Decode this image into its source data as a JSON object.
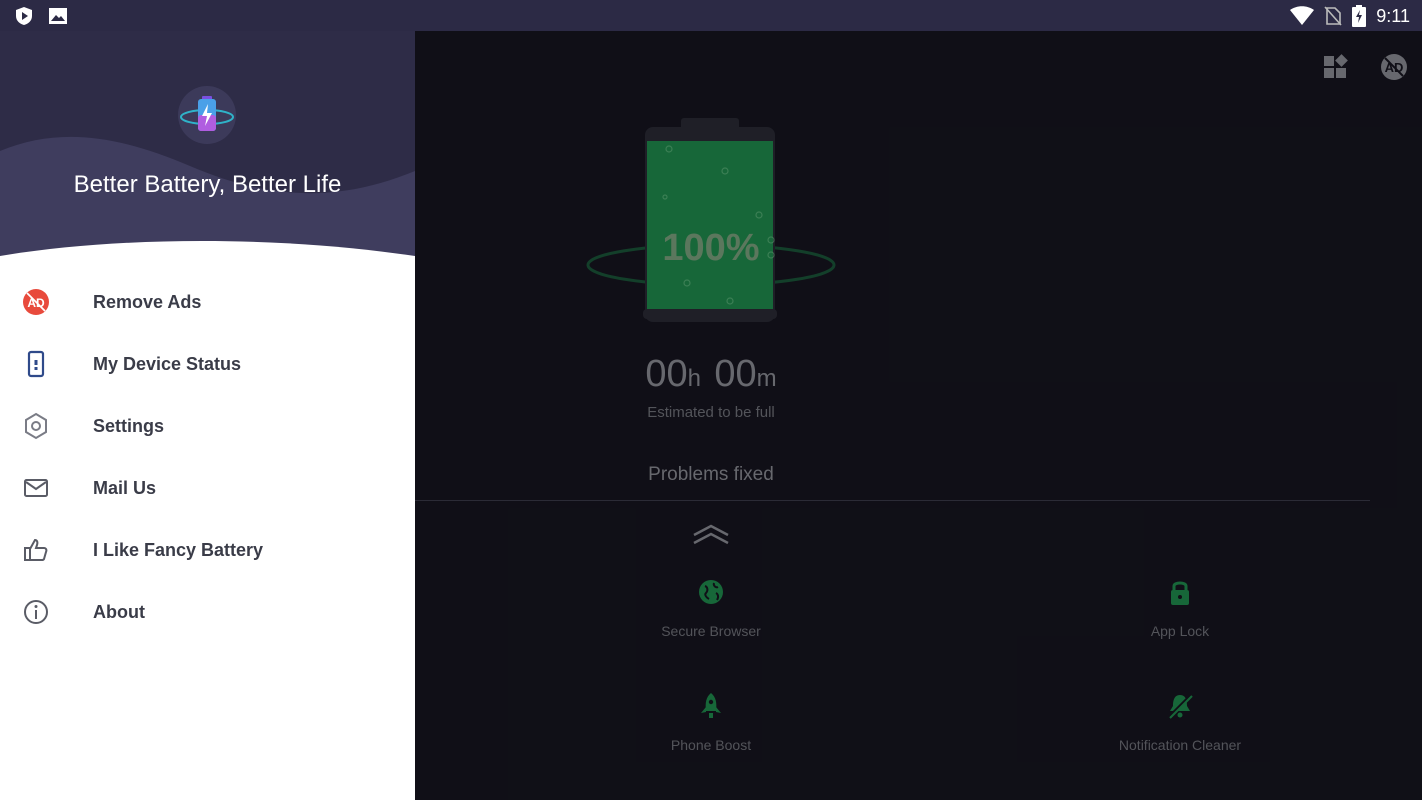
{
  "status_bar": {
    "time": "9:11",
    "left_icons": [
      "shield-play-icon",
      "image-icon"
    ],
    "right_icons": [
      "wifi-icon",
      "no-sim-icon",
      "battery-charging-icon"
    ]
  },
  "drawer": {
    "slogan": "Better Battery, Better Life",
    "items": [
      {
        "label": "Remove Ads",
        "icon": "no-ads-icon"
      },
      {
        "label": "My Device Status",
        "icon": "phone-icon"
      },
      {
        "label": "Settings",
        "icon": "gear-icon"
      },
      {
        "label": "Mail Us",
        "icon": "mail-icon"
      },
      {
        "label": "I Like Fancy Battery",
        "icon": "thumbs-up-icon"
      },
      {
        "label": "About",
        "icon": "info-icon"
      }
    ]
  },
  "main": {
    "battery_percent": "100%",
    "battery_level": 1.0,
    "hours": "00",
    "hours_unit": "h",
    "minutes": "00",
    "minutes_unit": "m",
    "estimate_label": "Estimated to be full",
    "problems_label": "Problems fixed",
    "features": [
      {
        "label": "Secure Browser",
        "icon": "globe-icon"
      },
      {
        "label": "App Lock",
        "icon": "lock-icon"
      },
      {
        "label": "Phone Boost",
        "icon": "rocket-icon"
      },
      {
        "label": "Notification Cleaner",
        "icon": "bell-off-icon"
      }
    ]
  },
  "colors": {
    "accent_green": "#1f8a4c",
    "drawer_header": "#3c3a5a",
    "status_bar": "#2c2a45"
  }
}
